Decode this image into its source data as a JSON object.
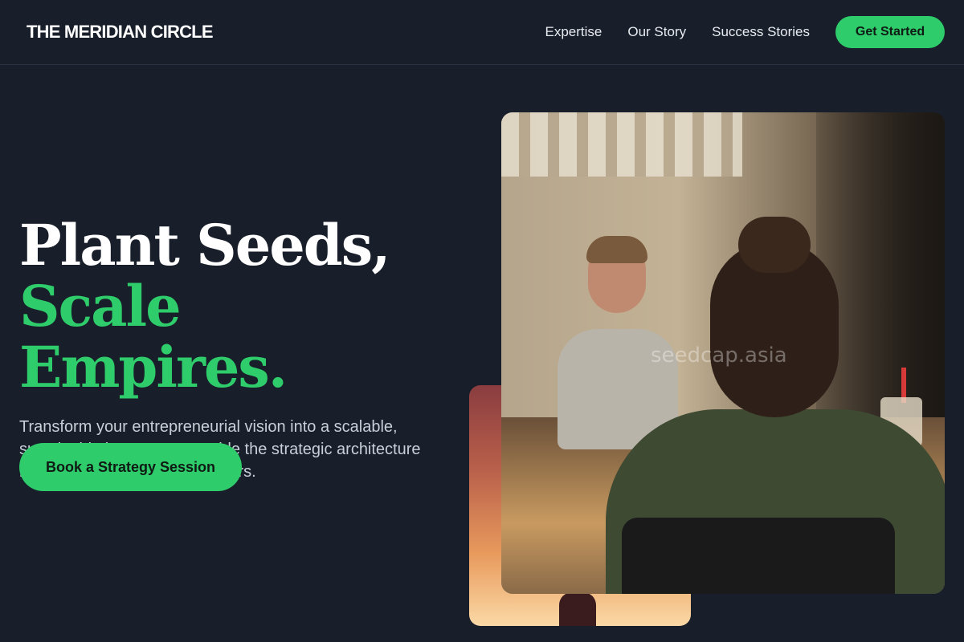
{
  "header": {
    "brand": "THE MERIDIAN CIRCLE",
    "nav": [
      {
        "label": "Expertise"
      },
      {
        "label": "Our Story"
      },
      {
        "label": "Success Stories"
      }
    ],
    "cta_label": "Get Started"
  },
  "hero": {
    "headline_line1": "Plant Seeds,",
    "headline_line2": "Scale Empires.",
    "lead": "Transform your entrepreneurial vision into a scalable, sustainable legacy. We provide the strategic architecture needed for high-growth founders.",
    "button_label": "Book a Strategy Session",
    "image_watermark": "seedcap.asia"
  },
  "colors": {
    "background": "#181e2a",
    "accent": "#2ecc6a",
    "text": "#ffffff",
    "muted_text": "#c9cfd8"
  }
}
